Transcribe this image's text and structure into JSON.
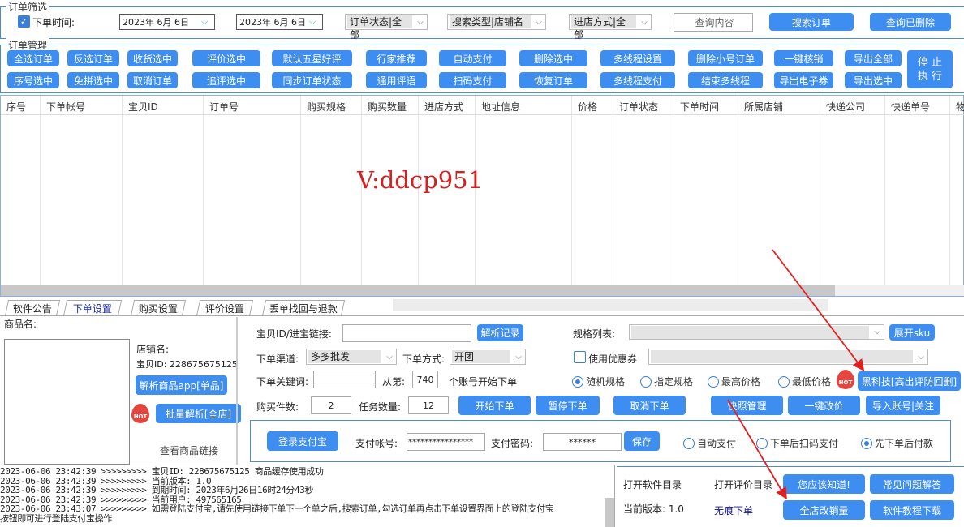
{
  "filter": {
    "legend": "订单筛选",
    "time_label": "下单时间:",
    "time_checked": true,
    "date_from": "2023年 6月 6日",
    "date_to": "2023年 6月 6日",
    "status": "订单状态|全部",
    "search_type": "搜索类型|店铺名",
    "entry": "进店方式|全部",
    "query_placeholder": "查询内容",
    "search_btn": "搜索订单",
    "deleted_btn": "查询已删除"
  },
  "manage": {
    "legend": "订单管理",
    "row1": [
      "全选订单",
      "反选订单",
      "收货选中",
      "评价选中",
      "默认五星好评",
      "行家推荐",
      "自动支付",
      "删除选中",
      "多线程设置",
      "删除小号订单",
      "一键核销",
      "导出全部"
    ],
    "row2": [
      "序号选中",
      "免拼选中",
      "取消订单",
      "追评选中",
      "同步订单状态",
      "通用评语",
      "扫码支付",
      "恢复订单",
      "多线程支付",
      "结束多线程",
      "导出电子券",
      "导出选中"
    ],
    "stop_l1": "停 止",
    "stop_l2": "执 行"
  },
  "table": {
    "columns": [
      "序号",
      "下单帐号",
      "宝贝ID",
      "订单号",
      "购买规格",
      "购买数量",
      "进店方式",
      "地址信息",
      "价格",
      "订单状态",
      "下单时间",
      "所属店铺",
      "快递公司",
      "快递单号",
      "物"
    ],
    "rows": []
  },
  "watermark": "V:ddcp951",
  "tabs": [
    "软件公告",
    "下单设置",
    "购买设置",
    "评价设置",
    "丢单找回与退款"
  ],
  "active_tab": 1,
  "left": {
    "product_name_label": "商品名:",
    "shop_label": "店铺名:",
    "item_id": "宝贝ID: 228675675125",
    "parse_app_btn": "解析商品app[单品]",
    "batch_btn": "批量解析[全店]",
    "hot": "HOT",
    "view_link": "查看商品链接"
  },
  "order": {
    "link_label": "宝贝ID/进宝链接:",
    "link_value": "",
    "parse_record_btn": "解析记录",
    "spec_label": "规格列表:",
    "expand_sku_btn": "展开sku",
    "channel_label": "下单渠道:",
    "channel": "多多批发",
    "mode_label": "下单方式:",
    "mode": "开团",
    "coupon_label": "使用优惠券",
    "coupon_checked": false,
    "keyword_label": "下单关键词:",
    "keyword": "",
    "from_label": "从第:",
    "from_value": "740",
    "from_suffix": "个账号开始下单",
    "spec_radios": [
      "随机规格",
      "指定规格",
      "最高价格",
      "最低价格"
    ],
    "spec_selected": 0,
    "hot": "HOT",
    "blacktech_btn": "黑科技[高出评防回删]",
    "qty_label": "购买件数:",
    "qty": "2",
    "tasks_label": "任务数量:",
    "tasks": "12",
    "start_btn": "开始下单",
    "pause_btn": "暂停下单",
    "cancel_btn": "取消下单",
    "snapshot_btn": "快照管理",
    "reprice_btn": "一键改价",
    "import_btn": "导入账号|关注"
  },
  "pay": {
    "login_btn": "登录支付宝",
    "account_label": "支付帐号:",
    "account": "****************",
    "pwd_label": "支付密码:",
    "pwd": "******",
    "save_btn": "保存",
    "radios": [
      "自动支付",
      "下单后扫码支付",
      "先下单后付款"
    ],
    "selected": 2
  },
  "log": [
    "2023-06-06 23:42:39 >>>>>>>>> 宝贝ID: 228675675125 商品缓存使用成功",
    "2023-06-06 23:42:39 >>>>>>>>> 当前版本: 1.0",
    "2023-06-06 23:42:39 >>>>>>>>> 到期时间: 2023年6月26日16时24分43秒",
    "2023-06-06 23:42:39 >>>>>>>>> 当前用户: 497565165",
    "2023-06-06 23:43:07 >>>>>>>>> 如需登陆支付宝,请先使用链接下单下一个单之后,搜索订单,勾选订单再点击下单设置界面上的登陆支付宝",
    "按钮即可进行登陆支付宝操作"
  ],
  "footer": {
    "open_dir": "打开软件目录",
    "open_review_dir": "打开评价目录",
    "version": "当前版本: 1.0",
    "no_trace": "无痕下单",
    "know_btn": "您应该知道!",
    "faq_btn": "常见问题解答",
    "shop_sales_btn": "全店改销量",
    "tutorial_btn": "软件教程下载"
  },
  "colors": {
    "accent": "#3d8ef0",
    "arrow": "#e02020",
    "watermark": "#d42020"
  }
}
